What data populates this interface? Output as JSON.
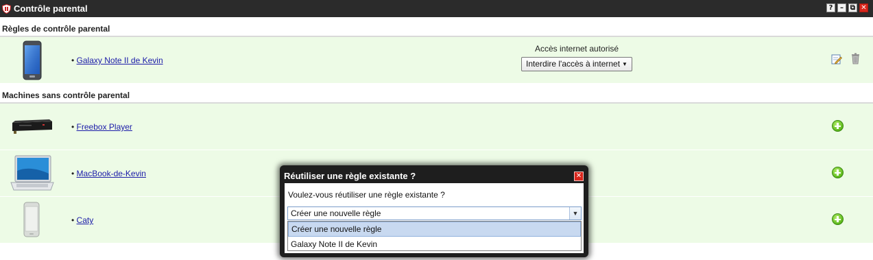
{
  "window": {
    "title": "Contrôle parental",
    "controls": {
      "help": "?",
      "minimize": "–",
      "restore": "⧉",
      "close": "✕"
    }
  },
  "sections": {
    "rules_title": "Règles de contrôle parental",
    "unmanaged_title": "Machines sans contrôle parental"
  },
  "rules": [
    {
      "device": "Galaxy Note II de Kevin",
      "device_icon": "smartphone-icon",
      "access_label": "Accès internet autorisé",
      "access_button": "Interdire l'accès à internet"
    }
  ],
  "machines": [
    {
      "name": "Freebox Player",
      "icon": "set-top-box-icon"
    },
    {
      "name": "MacBook-de-Kevin",
      "icon": "laptop-icon"
    },
    {
      "name": "Caty",
      "icon": "phone-icon"
    }
  ],
  "dialog": {
    "title": "Réutiliser une règle existante ?",
    "question": "Voulez-vous réutiliser une règle existante ?",
    "selected": "Créer une nouvelle règle",
    "options": [
      "Créer une nouvelle règle",
      "Galaxy Note II de Kevin"
    ]
  },
  "colors": {
    "titlebar": "#2b2b2b",
    "row_background": "#edfbe6",
    "close_red": "#d9261c",
    "add_green": "#5cb81b",
    "link": "#1a1aa8",
    "selected_option": "#c8d9f0"
  }
}
